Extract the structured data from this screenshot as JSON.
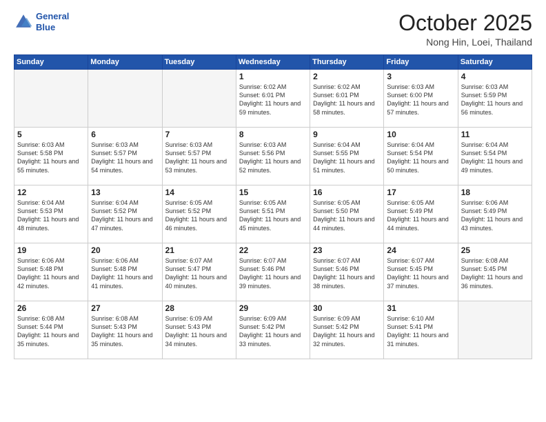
{
  "header": {
    "logo_line1": "General",
    "logo_line2": "Blue",
    "month": "October 2025",
    "location": "Nong Hin, Loei, Thailand"
  },
  "weekdays": [
    "Sunday",
    "Monday",
    "Tuesday",
    "Wednesday",
    "Thursday",
    "Friday",
    "Saturday"
  ],
  "weeks": [
    [
      {
        "day": "",
        "empty": true
      },
      {
        "day": "",
        "empty": true
      },
      {
        "day": "",
        "empty": true
      },
      {
        "day": "1",
        "sunrise": "6:02 AM",
        "sunset": "6:01 PM",
        "daylight": "11 hours and 59 minutes."
      },
      {
        "day": "2",
        "sunrise": "6:02 AM",
        "sunset": "6:01 PM",
        "daylight": "11 hours and 58 minutes."
      },
      {
        "day": "3",
        "sunrise": "6:03 AM",
        "sunset": "6:00 PM",
        "daylight": "11 hours and 57 minutes."
      },
      {
        "day": "4",
        "sunrise": "6:03 AM",
        "sunset": "5:59 PM",
        "daylight": "11 hours and 56 minutes."
      }
    ],
    [
      {
        "day": "5",
        "sunrise": "6:03 AM",
        "sunset": "5:58 PM",
        "daylight": "11 hours and 55 minutes."
      },
      {
        "day": "6",
        "sunrise": "6:03 AM",
        "sunset": "5:57 PM",
        "daylight": "11 hours and 54 minutes."
      },
      {
        "day": "7",
        "sunrise": "6:03 AM",
        "sunset": "5:57 PM",
        "daylight": "11 hours and 53 minutes."
      },
      {
        "day": "8",
        "sunrise": "6:03 AM",
        "sunset": "5:56 PM",
        "daylight": "11 hours and 52 minutes."
      },
      {
        "day": "9",
        "sunrise": "6:04 AM",
        "sunset": "5:55 PM",
        "daylight": "11 hours and 51 minutes."
      },
      {
        "day": "10",
        "sunrise": "6:04 AM",
        "sunset": "5:54 PM",
        "daylight": "11 hours and 50 minutes."
      },
      {
        "day": "11",
        "sunrise": "6:04 AM",
        "sunset": "5:54 PM",
        "daylight": "11 hours and 49 minutes."
      }
    ],
    [
      {
        "day": "12",
        "sunrise": "6:04 AM",
        "sunset": "5:53 PM",
        "daylight": "11 hours and 48 minutes."
      },
      {
        "day": "13",
        "sunrise": "6:04 AM",
        "sunset": "5:52 PM",
        "daylight": "11 hours and 47 minutes."
      },
      {
        "day": "14",
        "sunrise": "6:05 AM",
        "sunset": "5:52 PM",
        "daylight": "11 hours and 46 minutes."
      },
      {
        "day": "15",
        "sunrise": "6:05 AM",
        "sunset": "5:51 PM",
        "daylight": "11 hours and 45 minutes."
      },
      {
        "day": "16",
        "sunrise": "6:05 AM",
        "sunset": "5:50 PM",
        "daylight": "11 hours and 44 minutes."
      },
      {
        "day": "17",
        "sunrise": "6:05 AM",
        "sunset": "5:49 PM",
        "daylight": "11 hours and 44 minutes."
      },
      {
        "day": "18",
        "sunrise": "6:06 AM",
        "sunset": "5:49 PM",
        "daylight": "11 hours and 43 minutes."
      }
    ],
    [
      {
        "day": "19",
        "sunrise": "6:06 AM",
        "sunset": "5:48 PM",
        "daylight": "11 hours and 42 minutes."
      },
      {
        "day": "20",
        "sunrise": "6:06 AM",
        "sunset": "5:48 PM",
        "daylight": "11 hours and 41 minutes."
      },
      {
        "day": "21",
        "sunrise": "6:07 AM",
        "sunset": "5:47 PM",
        "daylight": "11 hours and 40 minutes."
      },
      {
        "day": "22",
        "sunrise": "6:07 AM",
        "sunset": "5:46 PM",
        "daylight": "11 hours and 39 minutes."
      },
      {
        "day": "23",
        "sunrise": "6:07 AM",
        "sunset": "5:46 PM",
        "daylight": "11 hours and 38 minutes."
      },
      {
        "day": "24",
        "sunrise": "6:07 AM",
        "sunset": "5:45 PM",
        "daylight": "11 hours and 37 minutes."
      },
      {
        "day": "25",
        "sunrise": "6:08 AM",
        "sunset": "5:45 PM",
        "daylight": "11 hours and 36 minutes."
      }
    ],
    [
      {
        "day": "26",
        "sunrise": "6:08 AM",
        "sunset": "5:44 PM",
        "daylight": "11 hours and 35 minutes."
      },
      {
        "day": "27",
        "sunrise": "6:08 AM",
        "sunset": "5:43 PM",
        "daylight": "11 hours and 35 minutes."
      },
      {
        "day": "28",
        "sunrise": "6:09 AM",
        "sunset": "5:43 PM",
        "daylight": "11 hours and 34 minutes."
      },
      {
        "day": "29",
        "sunrise": "6:09 AM",
        "sunset": "5:42 PM",
        "daylight": "11 hours and 33 minutes."
      },
      {
        "day": "30",
        "sunrise": "6:09 AM",
        "sunset": "5:42 PM",
        "daylight": "11 hours and 32 minutes."
      },
      {
        "day": "31",
        "sunrise": "6:10 AM",
        "sunset": "5:41 PM",
        "daylight": "11 hours and 31 minutes."
      },
      {
        "day": "",
        "empty": true
      }
    ]
  ]
}
